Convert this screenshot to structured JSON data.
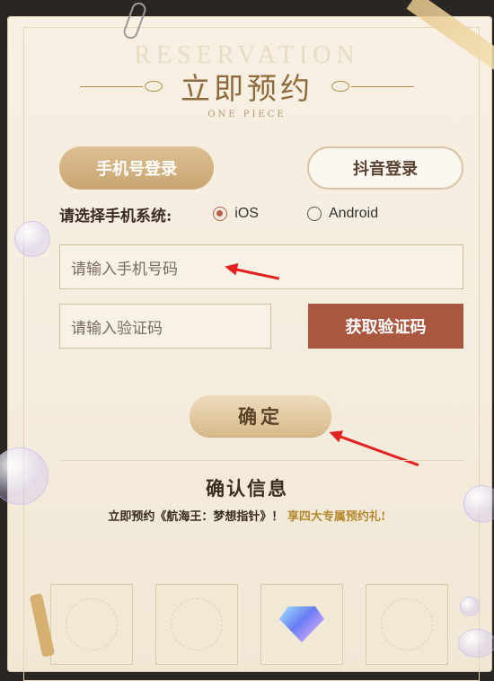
{
  "header": {
    "watermark": "RESERVATION",
    "title": "立即预约",
    "subtitle": "ONE PIECE"
  },
  "login_tabs": {
    "phone_label": "手机号登录",
    "douyin_label": "抖音登录"
  },
  "os_select": {
    "label": "请选择手机系统:",
    "options": [
      {
        "label": "iOS",
        "checked": true
      },
      {
        "label": "Android",
        "checked": false
      }
    ]
  },
  "form": {
    "phone_placeholder": "请输入手机号码",
    "code_placeholder": "请输入验证码",
    "get_code_label": "获取验证码",
    "confirm_label": "确定"
  },
  "info": {
    "title": "确认信息",
    "text_main": "立即预约《航海王：梦想指针》！",
    "text_highlight": "享四大专属预约礼!"
  },
  "colors": {
    "accent": "#a9573f",
    "arrow": "#e32222",
    "title": "#8f6a3c"
  },
  "icons": [
    "radio-checked-icon",
    "radio-unchecked-icon",
    "gem-icon",
    "arrow-annotation"
  ]
}
